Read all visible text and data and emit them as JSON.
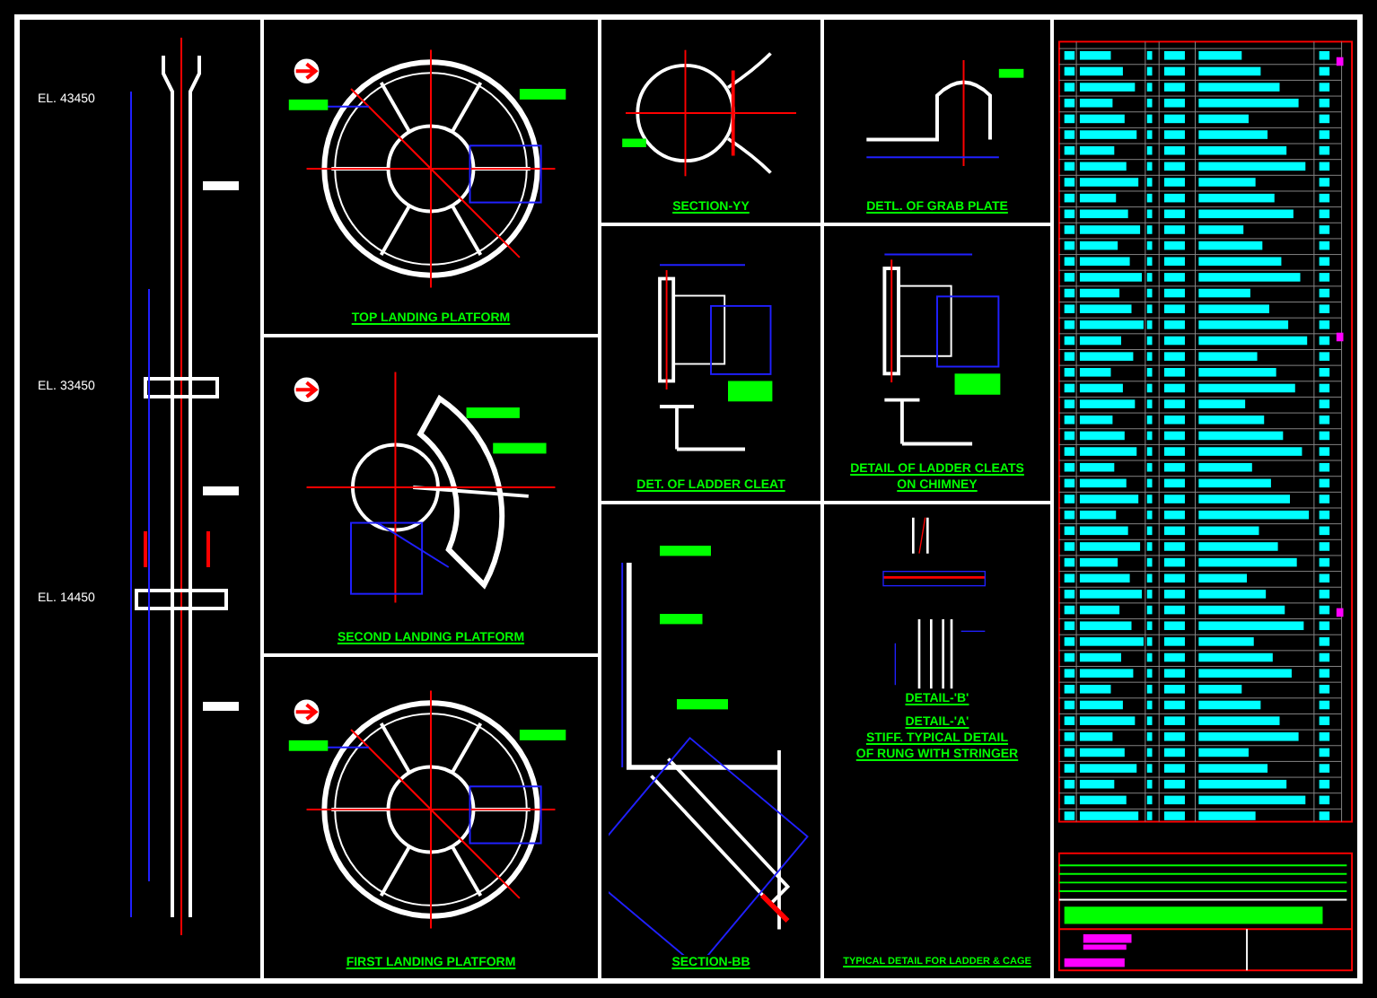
{
  "elevations": [
    {
      "text": "EL. 43450"
    },
    {
      "text": "EL. 33450"
    },
    {
      "text": "EL. 14450"
    }
  ],
  "columns": [
    {
      "panels": [
        {
          "kind": "ring",
          "title": [
            "TOP LANDING PLATFORM"
          ]
        },
        {
          "kind": "sector",
          "title": [
            "SECOND LANDING PLATFORM"
          ]
        },
        {
          "kind": "ring",
          "title": [
            "FIRST LANDING PLATFORM"
          ]
        }
      ]
    },
    {
      "panels": [
        {
          "kind": "section",
          "title": [
            "SECTION-YY"
          ]
        },
        {
          "kind": "cleat",
          "title": [
            "DET. OF LADDER CLEAT"
          ]
        },
        {
          "kind": "slope",
          "title": [
            "SECTION-BB"
          ]
        }
      ]
    },
    {
      "panels": [
        {
          "kind": "plate",
          "title": [
            "DETL. OF GRAB PLATE"
          ]
        },
        {
          "kind": "cleat",
          "title": [
            "DETAIL OF LADDER CLEATS",
            "ON CHIMNEY"
          ]
        },
        {
          "kind": "ladder",
          "title": [
            "DETAIL-'B'",
            "DETAIL-'A'",
            "STIFF. TYPICAL DETAIL",
            "OF RUNG WITH STRINGER",
            "TYPICAL DETAIL FOR LADDER & CAGE"
          ]
        }
      ]
    }
  ]
}
